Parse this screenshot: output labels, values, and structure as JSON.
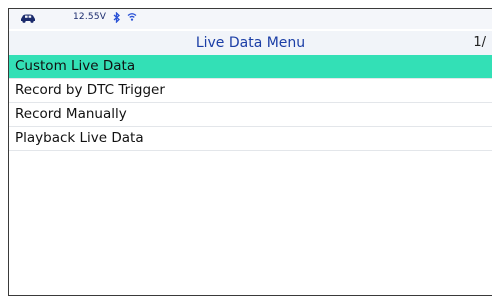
{
  "status_bar": {
    "voltage": "12.55V",
    "icons": [
      "car-icon",
      "bluetooth-icon",
      "wifi-icon"
    ]
  },
  "header": {
    "title": "Live Data Menu",
    "page_indicator": "1/"
  },
  "menu": {
    "items": [
      {
        "label": "Custom Live Data",
        "selected": true
      },
      {
        "label": "Record by DTC Trigger",
        "selected": false
      },
      {
        "label": "Record Manually",
        "selected": false
      },
      {
        "label": "Playback Live Data",
        "selected": false
      }
    ]
  },
  "colors": {
    "selected_row": "#33e0b6",
    "title_text": "#1b3ea6",
    "status_icons": "#1a2a6c"
  }
}
